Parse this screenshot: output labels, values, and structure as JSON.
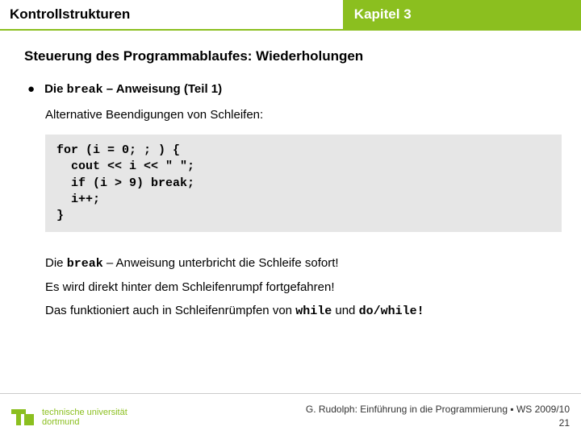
{
  "header": {
    "left": "Kontrollstrukturen",
    "right": "Kapitel 3"
  },
  "subtitle": "Steuerung des Programmablaufes: Wiederholungen",
  "bullet": {
    "pre": "Die ",
    "kw": "break",
    "post": " – Anweisung (Teil 1)"
  },
  "alt_line": "Alternative Beendigungen von Schleifen:",
  "code": "for (i = 0; ; ) {\n  cout << i << \" \";\n  if (i > 9) break;\n  i++;\n}",
  "para1": {
    "pre": "Die ",
    "kw": "break",
    "post": " – Anweisung unterbricht die Schleife sofort!"
  },
  "para2": "Es wird direkt hinter dem Schleifenrumpf fortgefahren!",
  "para3": {
    "pre": "Das funktioniert auch in Schleifenrümpfen von ",
    "kw1": "while",
    "mid": " und ",
    "kw2": "do/while!"
  },
  "footer": {
    "uni_line1": "technische universität",
    "uni_line2": "dortmund",
    "credit": "G. Rudolph: Einführung in die Programmierung ▪ WS 2009/10",
    "slide": "21"
  }
}
